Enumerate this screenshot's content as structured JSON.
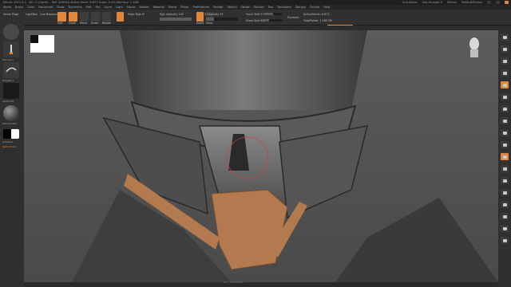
{
  "app": {
    "title": "ZBrush 2021.5.1 - Dir: C:\\Users\\... Ref: Untitled  Active Mesh: 8.873  Scale: 0.4%  Memory: 1.2GB",
    "right_items": [
      "QuickSave",
      "See-through 0",
      "Menus",
      "DefaultZScript"
    ]
  },
  "menu": [
    "Alpha",
    "Brush",
    "Color",
    "Document",
    "Draw",
    "Dynamics",
    "Edit",
    "File",
    "Layer",
    "Light",
    "Macro",
    "Marker",
    "Material",
    "Movie",
    "Picker",
    "Preferences",
    "Render",
    "Stencil",
    "Stroke",
    "Texture",
    "Tool",
    "Transform",
    "Zplugin",
    "Zscript",
    "Help"
  ],
  "shelf": {
    "home_page": "Home Page",
    "lightbox": "LightBox",
    "live_boolean": "Live Boolean",
    "edit": "Edit",
    "draw": "Draw",
    "move": "Move",
    "scale": "Scale",
    "rotate": "Rotate",
    "mrgb": "Mrgb",
    "rgb": "Rgb",
    "m": "M",
    "rgb_intensity": "Rgb Intensity 100",
    "zadd": "Zadd",
    "zsub": "Zsub",
    "z_intensity": "Z Intensity 25",
    "focal_shift": "Focal Shift 0",
    "draw_size": "Draw Size 64",
    "dynamic": "Dynamic",
    "active_points": "ActivePoints: 8.873",
    "total_points": "TotalPoints: 1.185 Mil"
  },
  "left_panel": {
    "brush_label": "Standard",
    "stroke_label": "DragRect",
    "alpha_label": "Alpha Off",
    "material_label": "SkinShade4",
    "gradient_label": "Gradient",
    "switch_label": "SwitchColor"
  },
  "right_panel": {
    "buttons": [
      "BPR",
      "SPix 3",
      "Scroll",
      "Zoom",
      "Actual",
      "AAHalf",
      "Dynamic Persp",
      "Floor",
      "L.Sym",
      "Frame",
      "Move",
      "Zoom3D",
      "Rotate",
      "Line Fill PolyF",
      "Transp",
      "Ghost",
      "Solo",
      "Xpose"
    ],
    "active": [
      4,
      10
    ]
  },
  "viewport": {
    "doc_info": "Doc: 1920x1080"
  },
  "colors": {
    "accent": "#e0873a",
    "panel": "#2f2f2f",
    "viewport": "#5a5a5a",
    "mask_orange": "#b27a4e"
  }
}
